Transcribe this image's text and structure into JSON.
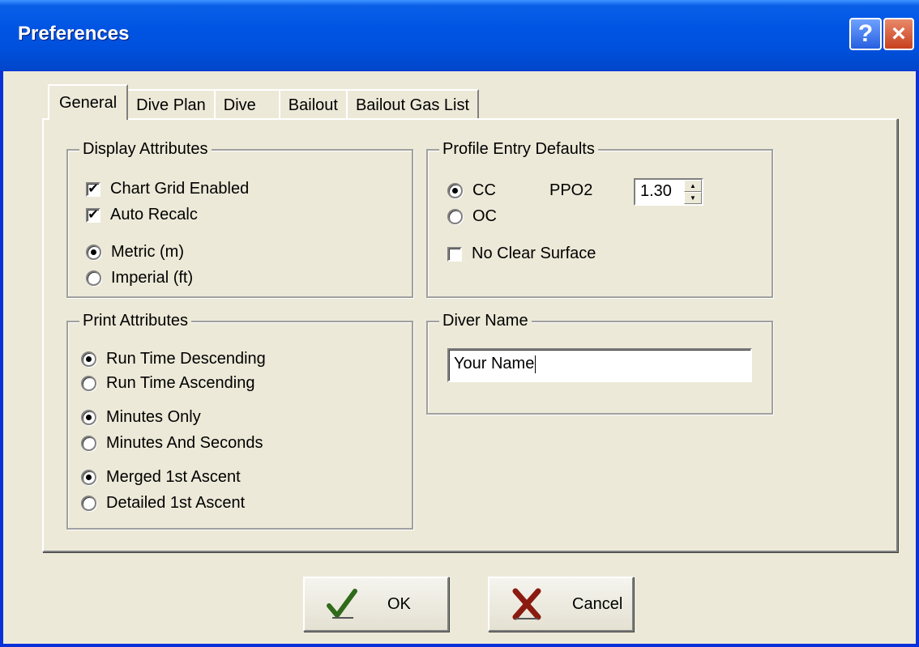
{
  "window": {
    "title": "Preferences"
  },
  "titlebar": {
    "help_glyph": "?",
    "close_glyph": "×"
  },
  "tabs": [
    {
      "label": "General",
      "active": true
    },
    {
      "label": "Dive Plan",
      "active": false
    },
    {
      "label": "Dive",
      "active": false
    },
    {
      "label": "Bailout",
      "active": false
    },
    {
      "label": "Bailout Gas List",
      "active": false
    }
  ],
  "display_attributes": {
    "title": "Display Attributes",
    "chart_grid": {
      "label": "Chart Grid Enabled",
      "checked": true
    },
    "auto_recalc": {
      "label": "Auto Recalc",
      "checked": true
    },
    "metric": {
      "label": "Metric (m)",
      "selected": true
    },
    "imperial": {
      "label": "Imperial (ft)",
      "selected": false
    }
  },
  "profile_entry": {
    "title": "Profile Entry Defaults",
    "cc": {
      "label": "CC",
      "selected": true
    },
    "oc": {
      "label": "OC",
      "selected": false
    },
    "ppo2_label": "PPO2",
    "ppo2_value": "1.30",
    "no_clear_surface": {
      "label": "No Clear Surface",
      "checked": false
    }
  },
  "print_attributes": {
    "title": "Print Attributes",
    "run_time_desc": {
      "label": "Run Time Descending",
      "selected": true
    },
    "run_time_asc": {
      "label": "Run Time Ascending",
      "selected": false
    },
    "minutes_only": {
      "label": "Minutes Only",
      "selected": true
    },
    "minutes_seconds": {
      "label": "Minutes And Seconds",
      "selected": false
    },
    "merged_ascent": {
      "label": "Merged 1st Ascent",
      "selected": true
    },
    "detailed_ascent": {
      "label": "Detailed 1st Ascent",
      "selected": false
    }
  },
  "diver": {
    "title": "Diver Name",
    "name_value": "Your Name"
  },
  "buttons": {
    "ok": "OK",
    "cancel": "Cancel"
  },
  "colors": {
    "titlebar": "#0054e3",
    "face": "#ece9d8",
    "ok_check": "#2f6b1a",
    "cancel_x": "#8b1a10"
  }
}
